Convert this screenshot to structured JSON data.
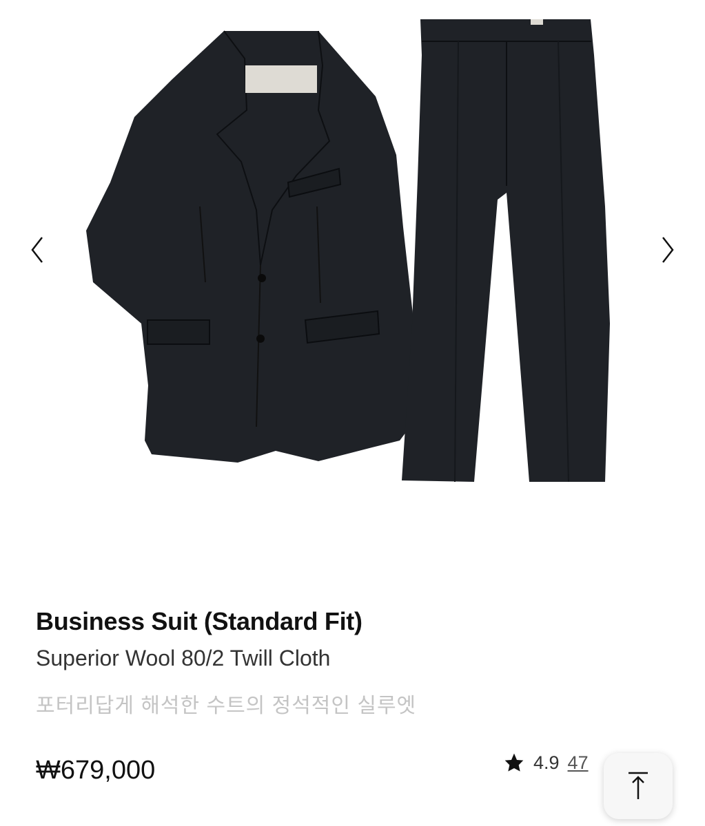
{
  "product": {
    "title": "Business Suit (Standard Fit)",
    "subtitle": "Superior Wool 80/2 Twill Cloth",
    "description": "포터리답게 해석한 수트의 정석적인 실루엣",
    "price": "₩679,000",
    "rating": "4.9",
    "review_count": "47"
  },
  "gallery": {
    "prev_icon": "chevron-left-icon",
    "next_icon": "chevron-right-icon"
  },
  "scroll_top": {
    "icon": "arrow-up-to-top-icon"
  },
  "colors": {
    "suit": "#1e2126",
    "background": "#ffffff"
  }
}
